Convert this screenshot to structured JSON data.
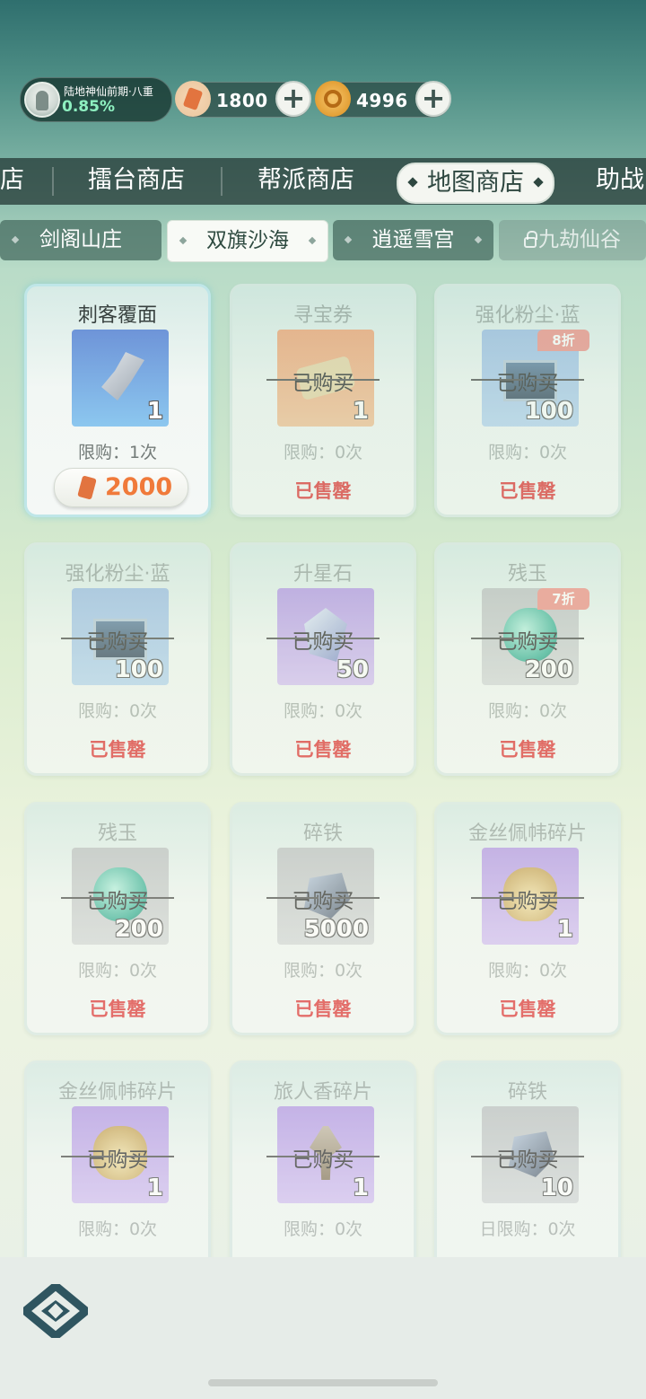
{
  "player": {
    "realm": "陆地神仙前期·八重",
    "progress": "0.85%"
  },
  "currencies": [
    {
      "icon": "ticket-icon",
      "value": "1800"
    },
    {
      "icon": "coin-icon",
      "value": "4996"
    }
  ],
  "shop_tabs": [
    {
      "label": "店",
      "active": false
    },
    {
      "label": "擂台商店",
      "active": false
    },
    {
      "label": "帮派商店",
      "active": false
    },
    {
      "label": "地图商店",
      "active": true
    },
    {
      "label": "助战",
      "active": false
    }
  ],
  "area_tabs": [
    {
      "label": "剑阁山庄",
      "active": false
    },
    {
      "label": "双旗沙海",
      "active": true
    },
    {
      "label": "逍遥雪宫",
      "active": false
    },
    {
      "label": "九劫仙谷",
      "locked": true
    }
  ],
  "items": [
    {
      "name": "刺客覆面",
      "qty": "1",
      "limit": "限购：1次",
      "price": "2000",
      "state": "available",
      "icon": "mask-icon"
    },
    {
      "name": "寻宝券",
      "qty": "1",
      "limit": "限购：0次",
      "bought": "已购买",
      "status": "已售罄",
      "icon": "scroll-icon"
    },
    {
      "name": "强化粉尘·蓝",
      "qty": "100",
      "limit": "限购：0次",
      "bought": "已购买",
      "status": "已售罄",
      "discount": "8折",
      "icon": "dust-box-icon"
    },
    {
      "name": "强化粉尘·蓝",
      "qty": "100",
      "limit": "限购：0次",
      "bought": "已购买",
      "status": "已售罄",
      "icon": "dust-box-icon"
    },
    {
      "name": "升星石",
      "qty": "50",
      "limit": "限购：0次",
      "bought": "已购买",
      "status": "已售罄",
      "icon": "crystal-icon"
    },
    {
      "name": "残玉",
      "qty": "200",
      "limit": "限购：0次",
      "bought": "已购买",
      "status": "已售罄",
      "discount": "7折",
      "icon": "jade-icon"
    },
    {
      "name": "残玉",
      "qty": "200",
      "limit": "限购：0次",
      "bought": "已购买",
      "status": "已售罄",
      "icon": "jade-icon"
    },
    {
      "name": "碎铁",
      "qty": "5000",
      "limit": "限购：0次",
      "bought": "已购买",
      "status": "已售罄",
      "icon": "iron-icon"
    },
    {
      "name": "金丝佩帏碎片",
      "qty": "1",
      "limit": "限购：0次",
      "bought": "已购买",
      "status": "已售罄",
      "icon": "pouch-icon"
    },
    {
      "name": "金丝佩帏碎片",
      "qty": "1",
      "limit": "限购：0次",
      "bought": "已购买",
      "icon": "pouch-icon"
    },
    {
      "name": "旅人香碎片",
      "qty": "1",
      "limit": "限购：0次",
      "bought": "已购买",
      "icon": "incense-icon"
    },
    {
      "name": "碎铁",
      "qty": "10",
      "limit": "日限购：0次",
      "bought": "已购买",
      "icon": "iron-icon"
    }
  ],
  "colors": {
    "soldout": "#e03c3c",
    "price": "#f07a3a",
    "discount": "#f0948c"
  }
}
